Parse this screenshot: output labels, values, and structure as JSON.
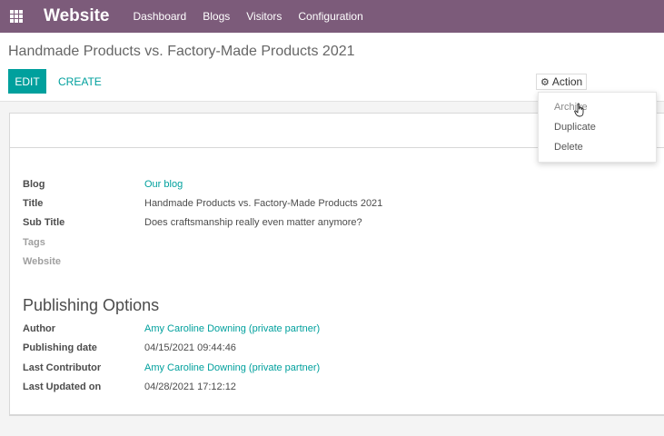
{
  "navbar": {
    "app_name": "Website",
    "menu": [
      "Dashboard",
      "Blogs",
      "Visitors",
      "Configuration"
    ]
  },
  "breadcrumb": "Handmade Products vs. Factory-Made Products 2021",
  "buttons": {
    "edit": "EDIT",
    "create": "CREATE",
    "action": "Action"
  },
  "action_menu": {
    "items": [
      "Archive",
      "Duplicate",
      "Delete"
    ]
  },
  "form": {
    "fields": [
      {
        "label": "Blog",
        "value": "Our blog"
      },
      {
        "label": "Title",
        "value": "Handmade Products vs. Factory-Made Products 2021"
      },
      {
        "label": "Sub Title",
        "value": "Does craftsmanship really even matter anymore?"
      },
      {
        "label": "Tags",
        "value": ""
      },
      {
        "label": "Website",
        "value": ""
      }
    ],
    "publishing_title": "Publishing Options",
    "publishing_fields": [
      {
        "label": "Author",
        "value": "Amy Caroline Downing (private partner)"
      },
      {
        "label": "Publishing date",
        "value": "04/15/2021 09:44:46"
      },
      {
        "label": "Last Contributor",
        "value": "Amy Caroline Downing (private partner)"
      },
      {
        "label": "Last Updated on",
        "value": "04/28/2021 17:12:12"
      }
    ]
  },
  "colors": {
    "navbar": "#7c5b7a",
    "primary": "#00a09d",
    "muted_label": "#a0a0a0"
  },
  "icons": {
    "apps": "grid-icon",
    "action": "gear-icon",
    "pointer": "hand-cursor-icon"
  }
}
